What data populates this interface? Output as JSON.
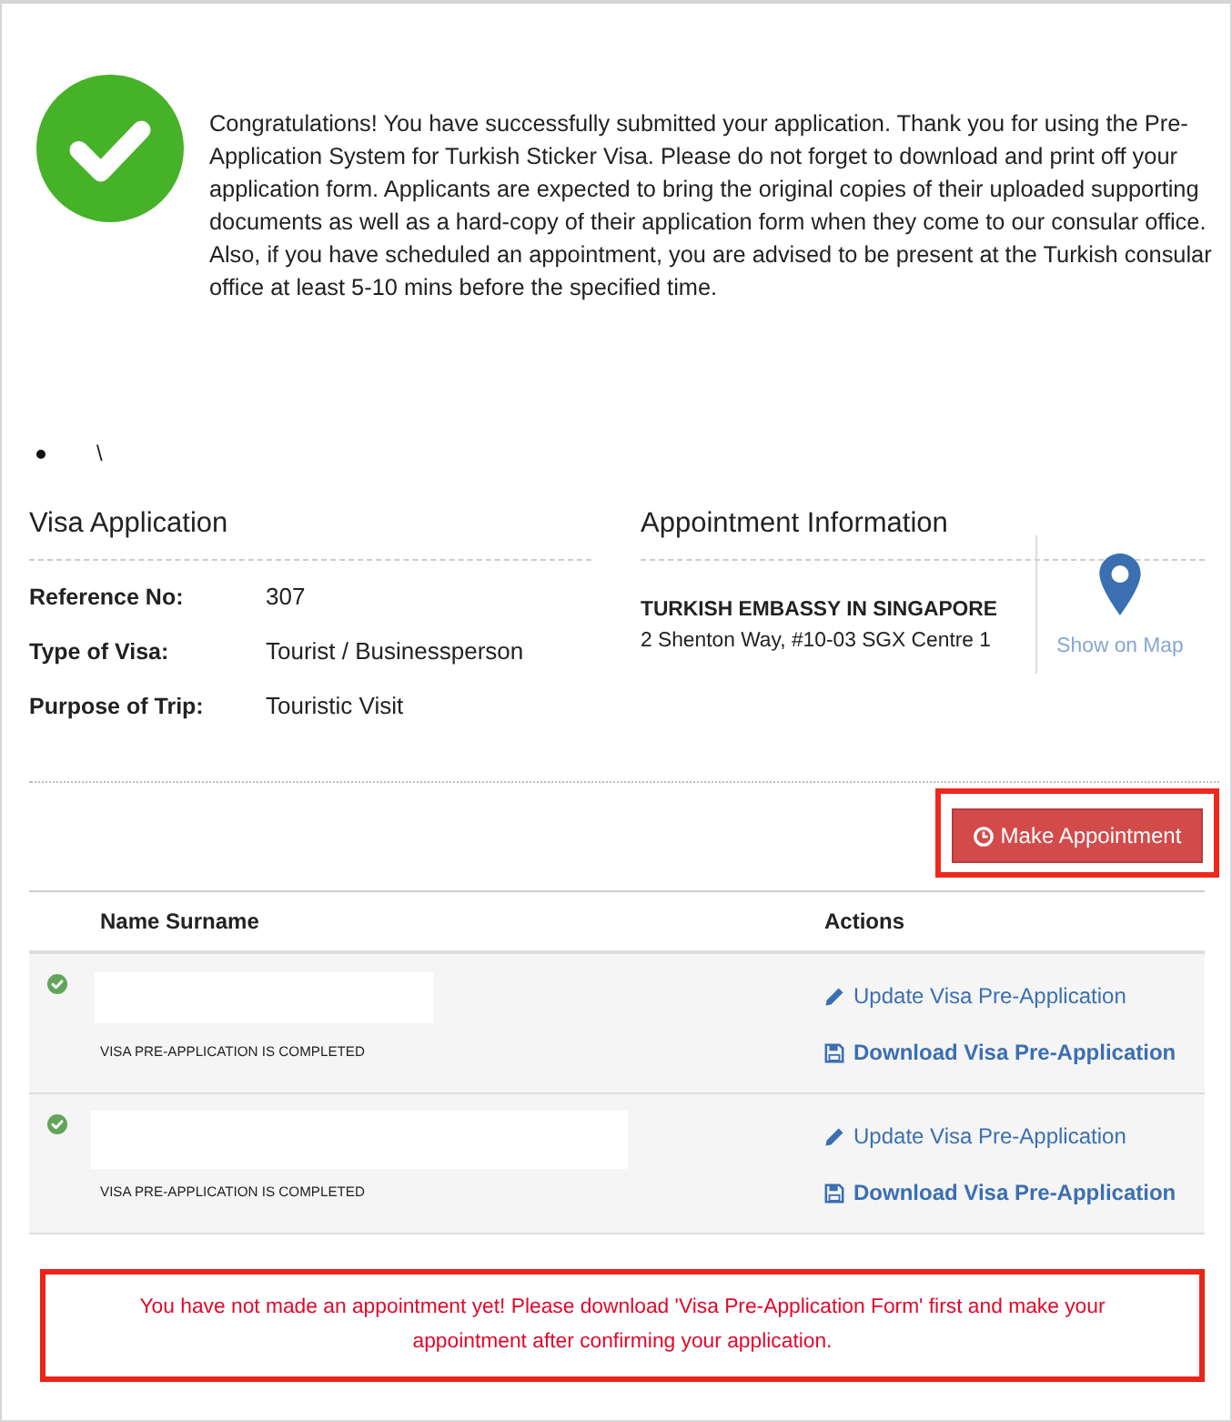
{
  "success_message": {
    "text": "Congratulations! You have successfully submitted your application. Thank you for using the Pre-Application System for Turkish Sticker Visa. Please do not forget to download and print off your application form. Applicants are expected to bring the original copies of their uploaded supporting documents as well as a hard-copy of their application form when they come to our consular office. Also, if you have scheduled an appointment, you are advised to be present at the Turkish consular office at least 5-10 mins before the specified time."
  },
  "list": [
    {
      "text": "\\"
    }
  ],
  "visa_application": {
    "title": "Visa Application",
    "fields": [
      {
        "label": "Reference No:",
        "value": "307"
      },
      {
        "label": "Type of Visa:",
        "value": "Tourist / Businessperson"
      },
      {
        "label": "Purpose of Trip:",
        "value": "Touristic Visit"
      }
    ]
  },
  "appointment_information": {
    "title": "Appointment Information",
    "office_name": "TURKISH EMBASSY IN SINGAPORE",
    "address": "2 Shenton Way, #10-03 SGX Centre 1",
    "map_link": "Show on Map"
  },
  "make_appointment_button": {
    "label": "Make Appointment",
    "highlighted": true
  },
  "table": {
    "columns": [
      "Name Surname",
      "Actions"
    ],
    "rows": [
      {
        "completed": true,
        "status": "VISA PRE-APPLICATION IS COMPLETED",
        "update_link": "Update Visa Pre-Application",
        "download_link": "Download Visa Pre-Application"
      },
      {
        "completed": true,
        "status": "VISA PRE-APPLICATION IS COMPLETED",
        "update_link": "Update Visa Pre-Application",
        "download_link": "Download Visa Pre-Application"
      }
    ]
  },
  "warning": {
    "text": "You have not made an appointment yet! Please download 'Visa Pre-Application Form' first and make your appointment after confirming your application.",
    "highlighted": true
  }
}
